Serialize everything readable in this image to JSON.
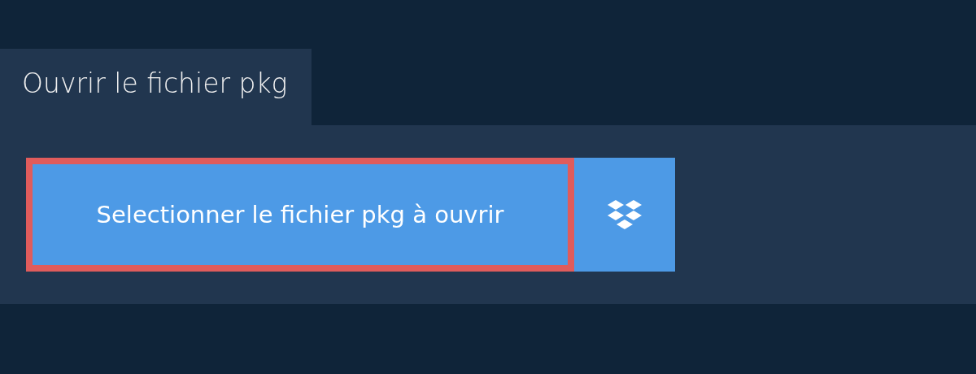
{
  "title": "Ouvrir le fichier pkg",
  "buttons": [
    {
      "kind": "select",
      "label": "Selectionner le fichier pkg à ouvrir",
      "focused": true
    },
    {
      "kind": "dropbox",
      "focused": false
    }
  ]
}
